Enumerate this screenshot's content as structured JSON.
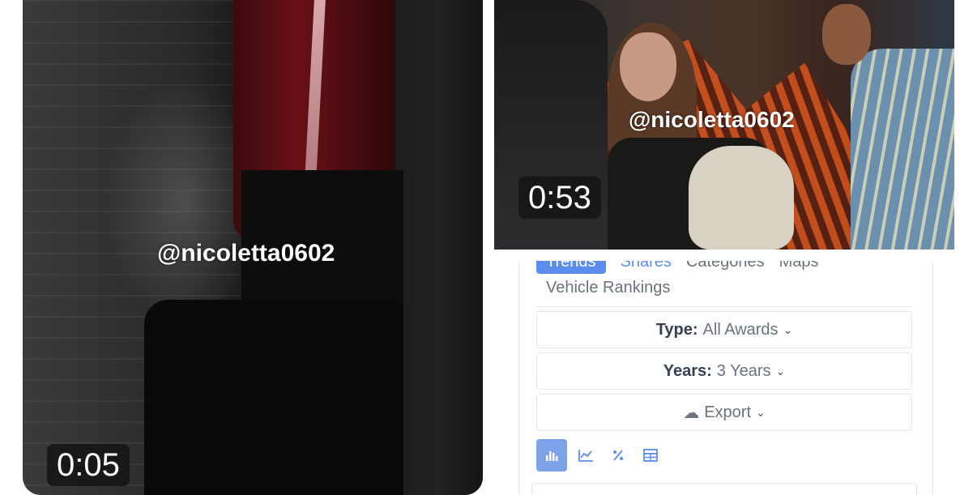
{
  "videos": [
    {
      "watermark": "@nicoletta0602",
      "duration": "0:05"
    },
    {
      "watermark": "@nicoletta0602",
      "duration": "0:53"
    }
  ],
  "panel": {
    "tabs": [
      {
        "label": "Trends",
        "state": "active"
      },
      {
        "label": "Shares",
        "state": "link"
      },
      {
        "label": "Categories",
        "state": "plain"
      },
      {
        "label": "Maps",
        "state": "plain"
      }
    ],
    "vehicle_rankings_tab": "Vehicle Rankings",
    "type_filter": {
      "label": "Type:",
      "value": "All Awards"
    },
    "years_filter": {
      "label": "Years:",
      "value": "3 Years"
    },
    "export_label": "Export",
    "view_icons": [
      "bar-chart-icon",
      "line-chart-icon",
      "percent-icon",
      "table-icon"
    ],
    "accent_color": "#5b8def"
  }
}
